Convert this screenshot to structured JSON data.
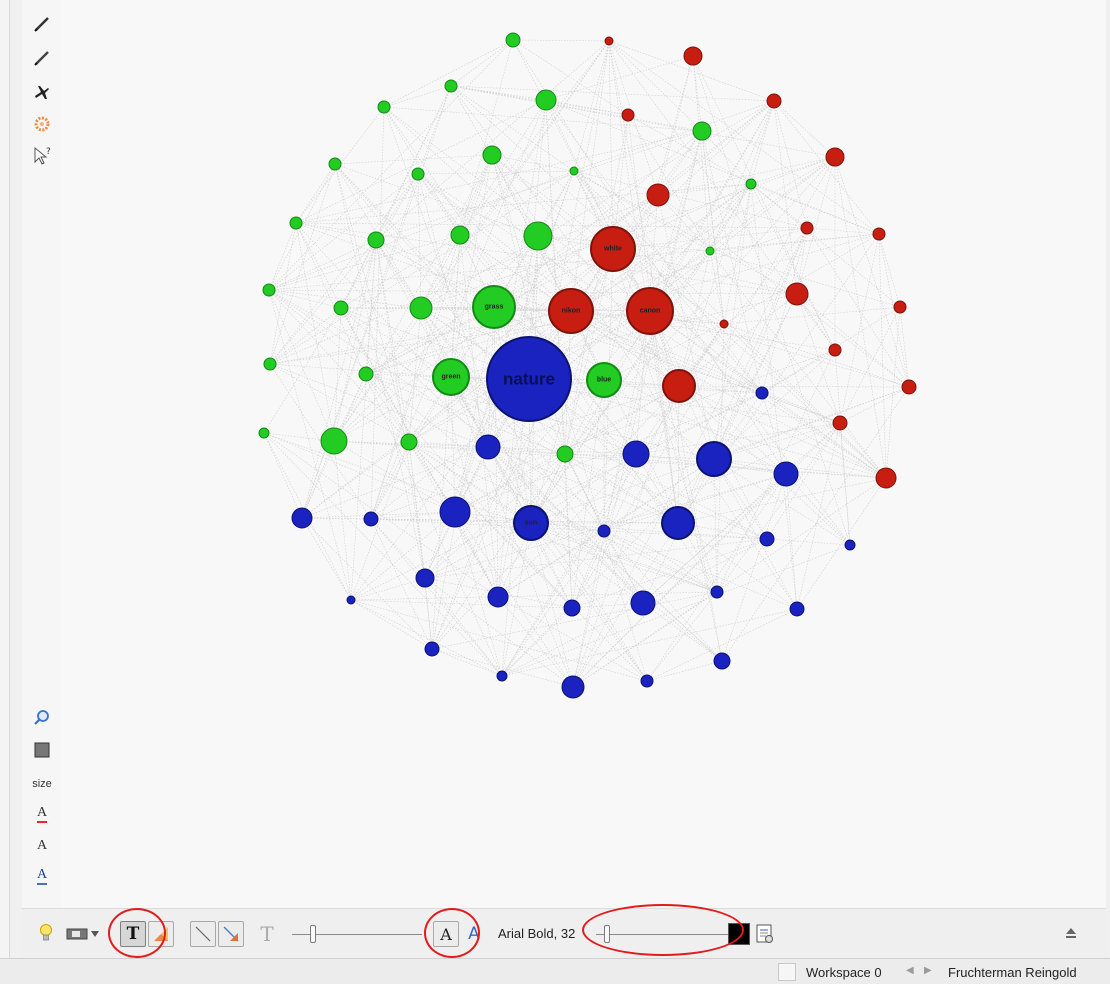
{
  "left_toolbar": {
    "tools": [
      {
        "name": "pencil-icon"
      },
      {
        "name": "edge-pencil-icon"
      },
      {
        "name": "plane-icon"
      },
      {
        "name": "painter-icon"
      },
      {
        "name": "pointer-help-icon"
      },
      {
        "name": "zoom-icon"
      },
      {
        "name": "square-icon"
      },
      {
        "name": "size-label"
      },
      {
        "name": "text-color-icon"
      },
      {
        "name": "text-size-icon"
      },
      {
        "name": "text-outline-icon"
      }
    ],
    "size_label": "size",
    "text_color_glyph": "A",
    "text_size_glyph": "A",
    "text_outline_glyph": "A"
  },
  "graph": {
    "colors": {
      "green": "#22cc22",
      "red": "#c81e12",
      "blue": "#1a22c0",
      "edge": "#cfcfcf"
    },
    "nodes": [
      {
        "label": "nature",
        "color": "blue"
      },
      {
        "label": "grass",
        "color": "green"
      },
      {
        "label": "green",
        "color": "green"
      },
      {
        "label": "blue",
        "color": "green"
      },
      {
        "label": "white",
        "color": "red"
      },
      {
        "label": "nikon",
        "color": "red"
      },
      {
        "label": "canon",
        "color": "red"
      },
      {
        "label": "sun",
        "color": "blue"
      }
    ]
  },
  "bottom_toolbar": {
    "font_name": "Arial Bold, 32",
    "font_color": "#000000",
    "text_button_glyph": "T",
    "font_button_glyph": "A",
    "text_size_glyph": "T",
    "font_icon_glyph": "A"
  },
  "status": {
    "workspace": "Workspace 0",
    "layout": "Fruchterman Reingold"
  }
}
